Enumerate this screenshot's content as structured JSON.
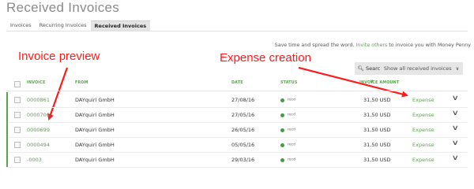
{
  "page_title": "Received Invoices",
  "tabs": [
    "Invoices",
    "Recurring Invoices",
    "Received Invoices"
  ],
  "spread": {
    "before": "Save time and spread the word.",
    "link": "Invite others",
    "after": "to invoice you with Money Penny"
  },
  "annotations": {
    "left": "Invoice preview",
    "right": "Expense creation"
  },
  "toolbar": {
    "search_label": "Search",
    "filter_label": "Show all received invoices"
  },
  "table": {
    "headers": {
      "invoice": "INVOICE",
      "from": "FROM",
      "date": "DATE",
      "status": "STATUS",
      "amount": "INVOICE AMOUNT"
    },
    "rows": [
      {
        "invoice": "0000861",
        "from": "DAYquiri GmbH",
        "date": "27/08/16",
        "status": "recd",
        "amount": "31,50 USD",
        "action": "Expense"
      },
      {
        "invoice": "0000700",
        "from": "DAYquiri GmbH",
        "date": "27/05/16",
        "status": "recd",
        "amount": "31,50 USD",
        "action": "Expense"
      },
      {
        "invoice": "0000699",
        "from": "DAYquiri GmbH",
        "date": "26/05/16",
        "status": "recd",
        "amount": "31,50 USD",
        "action": "Expense"
      },
      {
        "invoice": "0000494",
        "from": "DAYquiri GmbH",
        "date": "05/05/16",
        "status": "recd",
        "amount": "31,50 USD",
        "action": "Expense"
      },
      {
        "invoice": "-0003",
        "from": "DAYquiri GmbH",
        "date": "29/03/16",
        "status": "recd",
        "amount": "31,50 USD",
        "action": "Expense"
      }
    ]
  },
  "colors": {
    "accent": "#5aa44b",
    "annotation": "#ff1a1a",
    "status": "#3f9f3f"
  }
}
